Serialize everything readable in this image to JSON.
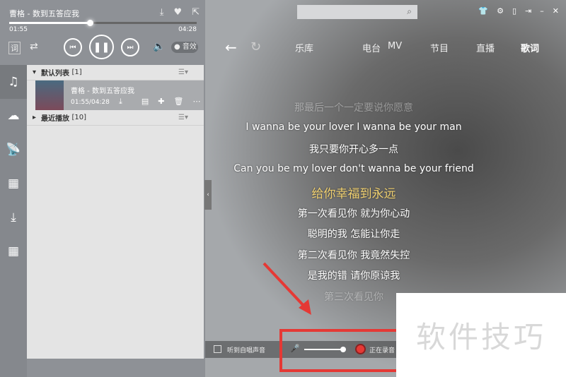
{
  "player": {
    "title": "曹格 - 数到五答应我",
    "elapsed": "01:55",
    "total": "04:28",
    "progress": 0.43,
    "effect_label": "音效",
    "lyric_btn": "词"
  },
  "playlist": {
    "groups": [
      {
        "name": "默认列表",
        "count": "[1]"
      },
      {
        "name": "最近播放",
        "count": "[10]"
      }
    ],
    "song": {
      "name": "曹格 - 数到五答应我",
      "time": "01:55/04:28"
    }
  },
  "nav": {
    "tabs": [
      "乐库",
      "电台",
      "MV",
      "节目",
      "直播",
      "歌词"
    ],
    "active": "歌词"
  },
  "search": {
    "placeholder": ""
  },
  "lyrics": {
    "lines": [
      "那最后一个一定要说你愿意",
      "I wanna be your lover I wanna be your man",
      "我只要你开心多一点",
      "Can you be my lover don't wanna be your friend",
      "给你幸福到永远",
      "第一次看见你 就为你心动",
      "聪明的我 怎能让你走",
      "第二次看见你 我竟然失控",
      "是我的错 请你原谅我",
      "第三次看见你"
    ],
    "current_index": 4
  },
  "karaoke": {
    "hear_self_label": "听到自唱声音",
    "recording_label": "正在录音",
    "mic_volume": 0.95
  },
  "watermark": "软件技巧",
  "colors": {
    "accent_lyric": "#f0d070",
    "record": "#e53935"
  }
}
